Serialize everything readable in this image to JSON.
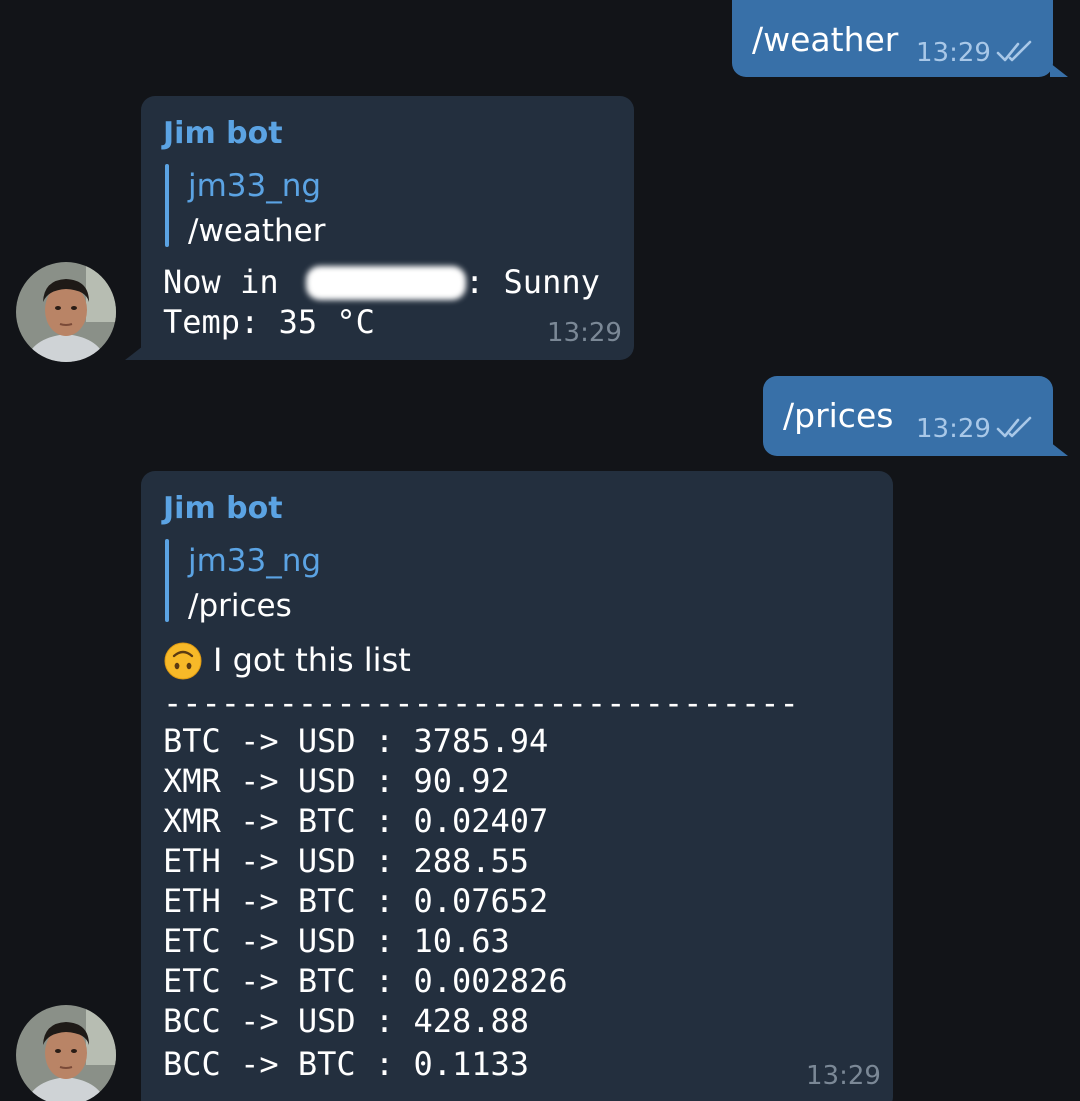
{
  "messages": {
    "out_weather": {
      "text": "/weather",
      "time": "13:29",
      "status_icon": "double-check-icon"
    },
    "in_weather": {
      "sender": "Jim bot",
      "reply_to": {
        "name": "jm33_ng",
        "text": "/weather"
      },
      "line1_prefix": "Now in ",
      "line1_suffix": ": Sunny",
      "line2": "Temp: 35 °C",
      "time": "13:29"
    },
    "out_prices": {
      "text": "/prices",
      "time": "13:29",
      "status_icon": "double-check-icon"
    },
    "in_prices": {
      "sender": "Jim bot",
      "reply_to": {
        "name": "jm33_ng",
        "text": "/prices"
      },
      "intro": "I got this list",
      "intro_icon": "upside-down-face-emoji",
      "divider": "---------------------------------",
      "rows": [
        "BTC -> USD : 3785.94",
        "XMR -> USD : 90.92",
        "XMR -> BTC : 0.02407",
        "ETH -> USD : 288.55",
        "ETH -> BTC : 0.07652",
        "ETC -> USD : 10.63",
        "ETC -> BTC : 0.002826",
        "BCC -> USD : 428.88",
        "BCC -> BTC : 0.1133"
      ],
      "time": "13:29"
    }
  },
  "colors": {
    "background": "#121418",
    "outgoing_bubble": "#3870a8",
    "incoming_bubble": "#232f3e",
    "accent": "#5ba3e3"
  }
}
